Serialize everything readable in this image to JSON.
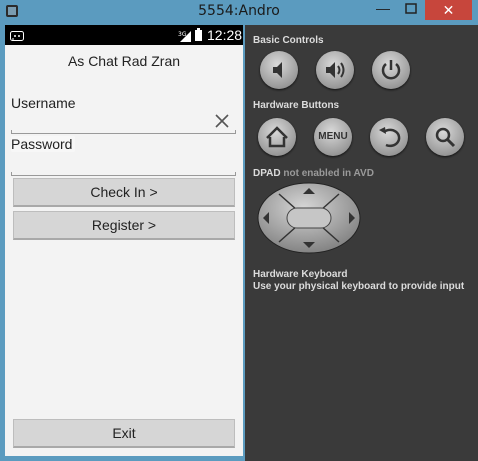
{
  "window": {
    "title": "5554:Andro",
    "minimize": "—",
    "close": "✕"
  },
  "status_bar": {
    "time": "12:28",
    "signal_label": "3G"
  },
  "app": {
    "title": "As Chat Rad Zran",
    "username_label": "Username",
    "username_value": "",
    "password_label": "Password",
    "password_value": "",
    "checkin_button": "Check In >",
    "register_button": "Register >",
    "exit_button": "Exit"
  },
  "controls": {
    "basic_label": "Basic Controls",
    "hardware_label": "Hardware Buttons",
    "menu_label": "MENU",
    "dpad_label": "DPAD",
    "dpad_note": "not enabled in AVD",
    "keyboard_title": "Hardware Keyboard",
    "keyboard_desc": "Use your physical keyboard to provide input"
  },
  "colors": {
    "controls_bg": "#3a3a3a",
    "phone_bg": "#f3f3f3",
    "button_bg": "#d6d6d6",
    "close_bg": "#c7463c"
  },
  "icons": [
    "volume-down-icon",
    "volume-up-icon",
    "power-icon",
    "home-icon",
    "menu-icon",
    "back-icon",
    "search-icon",
    "clear-icon"
  ]
}
